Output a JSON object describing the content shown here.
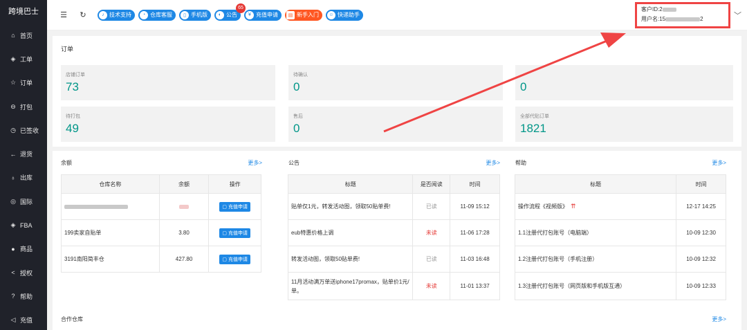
{
  "sidebar": {
    "brand": "跨境巴士",
    "items": [
      {
        "icon": "home-icon",
        "glyph": "⌂",
        "label": "首页"
      },
      {
        "icon": "diamond-icon",
        "glyph": "◈",
        "label": "工单"
      },
      {
        "icon": "star-icon",
        "glyph": "☆",
        "label": "订单"
      },
      {
        "icon": "box-icon",
        "glyph": "⊖",
        "label": "打包"
      },
      {
        "icon": "sign-icon",
        "glyph": "◷",
        "label": "已签收"
      },
      {
        "icon": "return-icon",
        "glyph": "←",
        "label": "退货"
      },
      {
        "icon": "outbound-icon",
        "glyph": "♁",
        "label": "出库"
      },
      {
        "icon": "globe-icon",
        "glyph": "◎",
        "label": "国际"
      },
      {
        "icon": "fba-icon",
        "glyph": "◈",
        "label": "FBA"
      },
      {
        "icon": "goods-icon",
        "glyph": "●",
        "label": "商品"
      },
      {
        "icon": "share-icon",
        "glyph": "<",
        "label": "授权"
      },
      {
        "icon": "help-icon",
        "glyph": "?",
        "label": "帮助"
      },
      {
        "icon": "recharge-icon",
        "glyph": "◁",
        "label": "充值"
      }
    ]
  },
  "topbar": {
    "buttons": [
      {
        "name": "tech-support",
        "label": "技术支持",
        "icon": "headset-icon",
        "glyph": "♪",
        "color": "blue"
      },
      {
        "name": "warehouse-service",
        "label": "仓库客服",
        "icon": "chat-icon",
        "glyph": "◔",
        "color": "blue"
      },
      {
        "name": "mobile",
        "label": "手机版",
        "icon": "phone-icon",
        "glyph": "▯",
        "color": "blue"
      },
      {
        "name": "notice",
        "label": "公告",
        "icon": "megaphone-icon",
        "glyph": "◐",
        "color": "blue",
        "badge": "65"
      },
      {
        "name": "recharge-apply",
        "label": "充值申请",
        "icon": "coin-icon",
        "glyph": "¥",
        "color": "blue"
      },
      {
        "name": "beginner",
        "label": "新手入门",
        "icon": "book-icon",
        "glyph": "▤",
        "color": "orange"
      },
      {
        "name": "express-helper",
        "label": "快递助手",
        "icon": "assistant-icon",
        "glyph": "☺",
        "color": "blue"
      }
    ],
    "user": {
      "customer_id_label": "客户ID:2",
      "username_label": "用户名:15",
      "username_suffix": "2"
    }
  },
  "orders": {
    "title": "订单",
    "stats": [
      {
        "label": "店铺订单",
        "value": "73"
      },
      {
        "label": "待确认",
        "value": "0"
      },
      {
        "label": "",
        "value": "0"
      },
      {
        "label": "待打包",
        "value": "49"
      },
      {
        "label": "售后",
        "value": "0"
      },
      {
        "label": "全部代贴订单",
        "value": "1821"
      }
    ]
  },
  "balance": {
    "title": "余额",
    "more": "更多>",
    "headers": [
      "仓库名称",
      "余额",
      "操作"
    ],
    "rows": [
      {
        "name": "",
        "amount": "",
        "action": "充值申请"
      },
      {
        "name": "199卖家自贴单",
        "amount": "3.80",
        "action": "充值申请"
      },
      {
        "name": "3191南阳简丰仓",
        "amount": "427.80",
        "action": "充值申请"
      }
    ]
  },
  "notices": {
    "title": "公告",
    "more": "更多>",
    "headers": [
      "标题",
      "是否阅读",
      "时间"
    ],
    "rows": [
      {
        "title": "贴单仅1元，转发活动图，领取50贴单费!",
        "status": "已读",
        "read": true,
        "time": "11-09 15:12"
      },
      {
        "title": "eub特惠价格上调",
        "status": "未读",
        "read": false,
        "time": "11-06 17:28"
      },
      {
        "title": "转发活动图，领取50贴单费!",
        "status": "已读",
        "read": true,
        "time": "11-03 16:48"
      },
      {
        "title": "11月活动满万单送iphone17promax，贴单价1元/单。",
        "status": "未读",
        "read": false,
        "time": "11-01 13:37"
      }
    ]
  },
  "help": {
    "title": "帮助",
    "more": "更多>",
    "headers": [
      "标题",
      "时间"
    ],
    "rows": [
      {
        "title": "操作流程《视频版》",
        "time": "12-17 14:25"
      },
      {
        "title": "1.1注册代打包账号（电脑端）",
        "time": "10-09 12:30"
      },
      {
        "title": "1.2注册代打包账号（手机注册）",
        "time": "10-09 12:32"
      },
      {
        "title": "1.3注册代打包账号（网页版和手机版互通）",
        "time": "10-09 12:33"
      }
    ]
  },
  "partner": {
    "title": "合作仓库",
    "more": "更多>"
  },
  "colors": {
    "accent": "#1e88e5",
    "stat_value": "#009688",
    "annotation": "#ef4444",
    "sidebar": "#20222a"
  }
}
